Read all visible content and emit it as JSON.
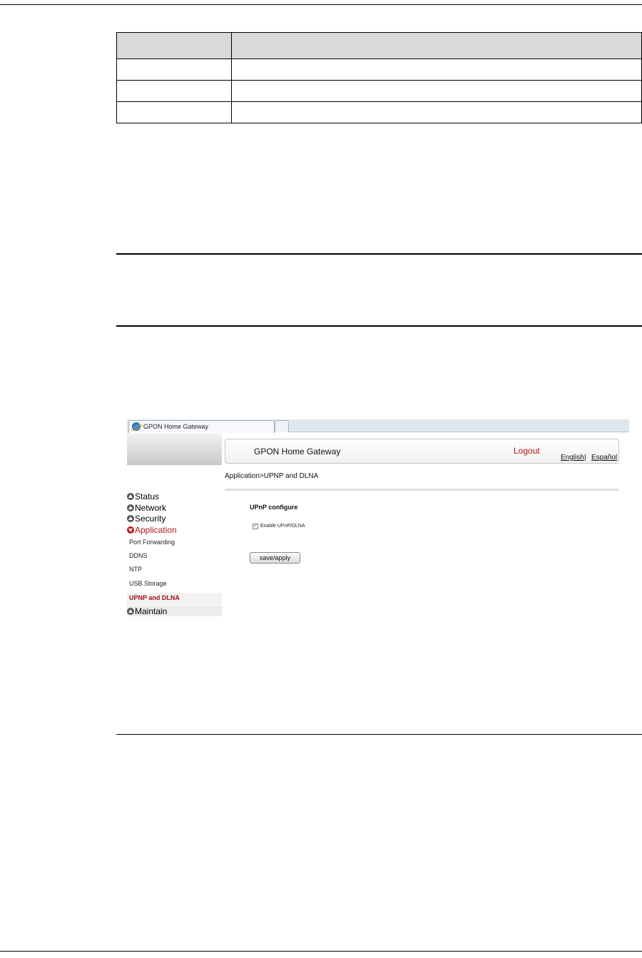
{
  "document": {
    "table_rows": [
      [
        "",
        ""
      ],
      [
        "",
        ""
      ],
      [
        "",
        ""
      ],
      [
        "",
        ""
      ]
    ]
  },
  "browser": {
    "tab_title": "GPON Home Gateway"
  },
  "gateway": {
    "title": "GPON Home Gateway",
    "logout": "Logout",
    "lang_english": "English",
    "lang_separator": "|",
    "lang_spanish": "Español",
    "breadcrumb": "Application>UPNP and DLNA",
    "nav": {
      "status": "Status",
      "network": "Network",
      "security": "Security",
      "application": "Application",
      "maintain": "Maintain"
    },
    "subnav": {
      "port_forwarding": "Port Forwarding",
      "ddns": "DDNS",
      "ntp": "NTP",
      "usb_storage": "USB Storage",
      "upnp_dlna": "UPNP and DLNA"
    },
    "section_title": "UPnP configure",
    "enable_label": "Enable UPnP/DLNA",
    "enable_checked": true,
    "save_label": "save/apply"
  },
  "colors": {
    "accent_red": "#b0161c",
    "rule": "#000000",
    "table_header": "#d9d9d9"
  }
}
